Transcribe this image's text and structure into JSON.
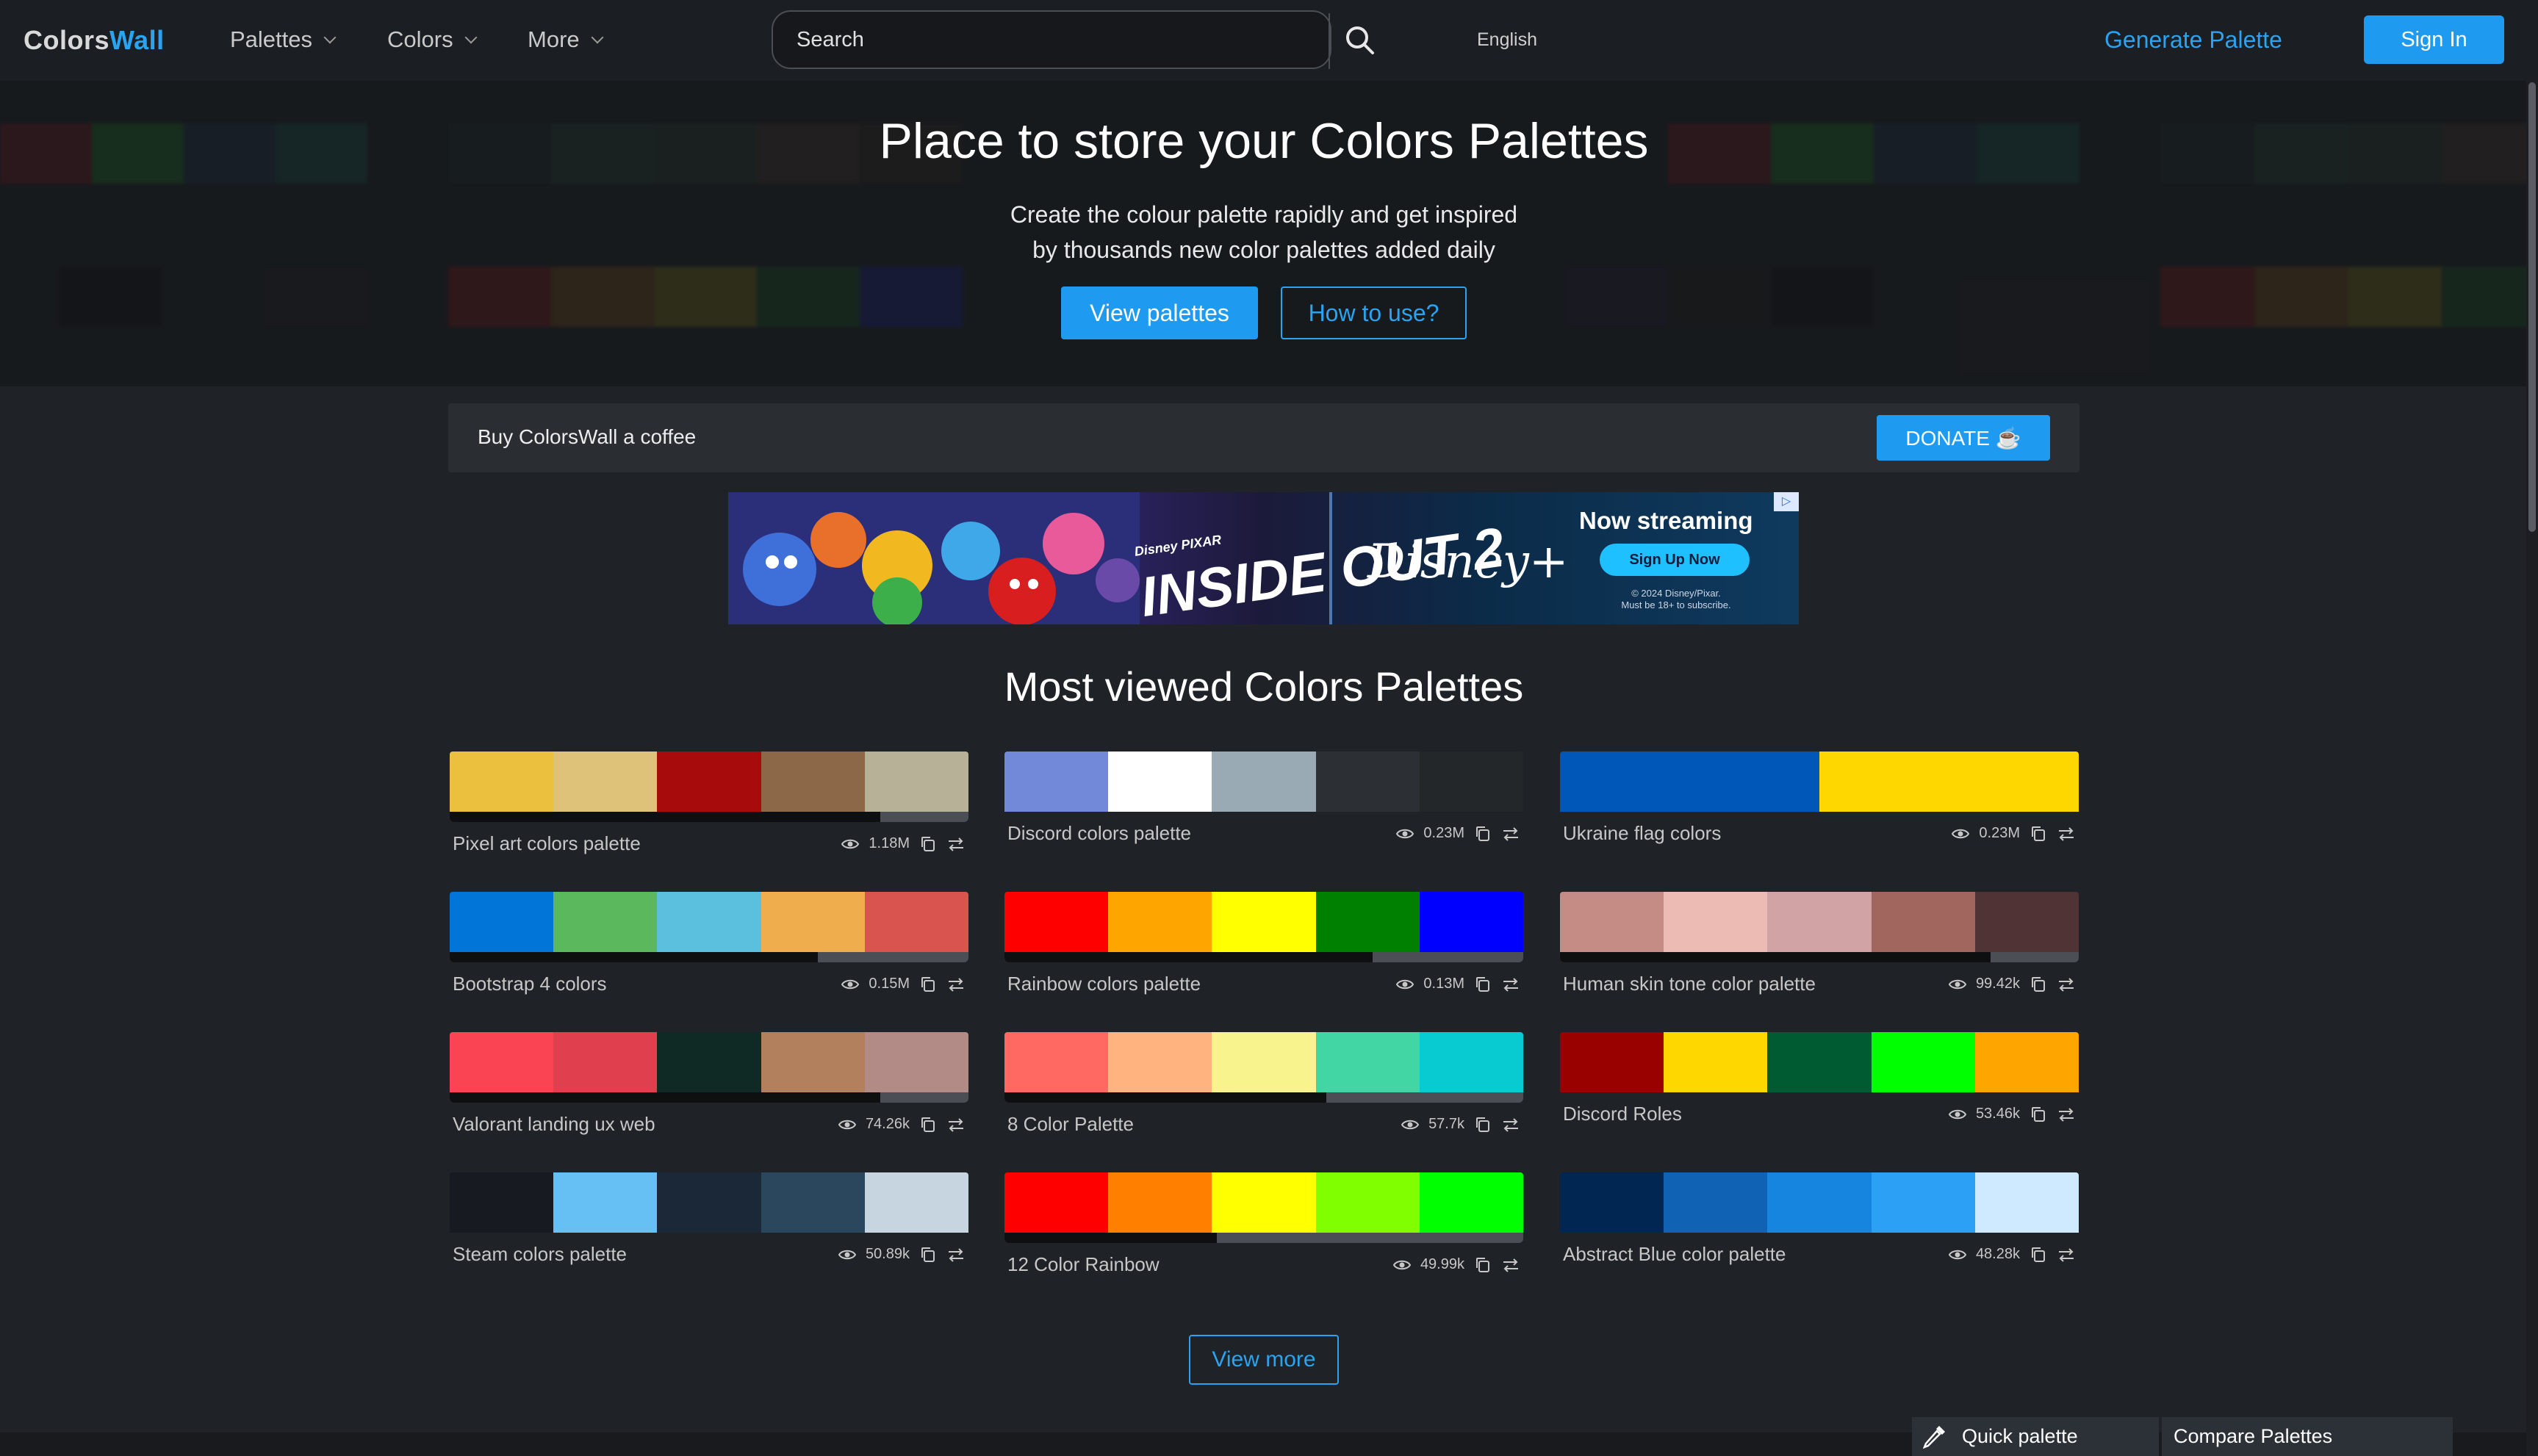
{
  "header": {
    "logo_part1": "Colors",
    "logo_part2": "Wall",
    "nav": [
      {
        "label": "Palettes"
      },
      {
        "label": "Colors"
      },
      {
        "label": "More"
      }
    ],
    "search_placeholder": "Search",
    "language": "English",
    "generate_label": "Generate Palette",
    "signin_label": "Sign In"
  },
  "hero": {
    "title": "Place to store your Colors Palettes",
    "subtitle_line1": "Create the colour palette rapidly and get inspired",
    "subtitle_line2": "by thousands new color palettes added daily",
    "view_palettes_label": "View palettes",
    "how_to_use_label": "How to use?"
  },
  "coffee": {
    "text": "Buy ColorsWall a coffee",
    "donate_label": "DONATE"
  },
  "ad": {
    "title": "INSIDE OUT 2",
    "title_kicker": "Disney PIXAR",
    "brand": "Disney+",
    "headline": "Now streaming",
    "cta": "Sign Up Now",
    "legal_line1": "© 2024 Disney/Pixar.",
    "legal_line2": "Must be 18+ to subscribe."
  },
  "section_title": "Most viewed Colors Palettes",
  "palettes": [
    {
      "name": "Pixel art colors palette",
      "views": "1.18M",
      "popularity": 0.83,
      "colors": [
        "#ebc03f",
        "#dfc27a",
        "#a80b0c",
        "#8c6748",
        "#b6b197"
      ]
    },
    {
      "name": "Discord colors palette",
      "views": "0.23M",
      "popularity": 0,
      "colors": [
        "#7289da",
        "#ffffff",
        "#99aab5",
        "#2c2f33",
        "#23272a"
      ]
    },
    {
      "name": "Ukraine flag colors",
      "views": "0.23M",
      "popularity": 0,
      "colors": [
        "#0057b7",
        "#ffd700"
      ]
    },
    {
      "name": "Bootstrap 4 colors",
      "views": "0.15M",
      "popularity": 0.71,
      "colors": [
        "#0275d8",
        "#5cb85c",
        "#5bc0de",
        "#f0ad4e",
        "#d9534f"
      ]
    },
    {
      "name": "Rainbow colors palette",
      "views": "0.13M",
      "popularity": 0.71,
      "colors": [
        "#ff0000",
        "#ffa500",
        "#ffff00",
        "#008000",
        "#0000ff"
      ]
    },
    {
      "name": "Human skin tone color palette",
      "views": "99.42k",
      "popularity": 0.83,
      "colors": [
        "#c58c85",
        "#ecbcb4",
        "#d1a3a4",
        "#a1665e",
        "#503335"
      ]
    },
    {
      "name": "Valorant landing ux web",
      "views": "74.26k",
      "popularity": 0.83,
      "colors": [
        "#fa4454",
        "#e0404e",
        "#0f2a25",
        "#b3805d",
        "#b28b86"
      ]
    },
    {
      "name": "8 Color Palette",
      "views": "57.7k",
      "popularity": 0.62,
      "colors": [
        "#ff6961",
        "#ffb480",
        "#f8f38d",
        "#42d6a4",
        "#08cad1"
      ]
    },
    {
      "name": "Discord Roles",
      "views": "53.46k",
      "popularity": 0,
      "colors": [
        "#990000",
        "#ffd700",
        "#005a32",
        "#00ff00",
        "#ffa500"
      ]
    },
    {
      "name": "Steam colors palette",
      "views": "50.89k",
      "popularity": 0,
      "colors": [
        "#171a21",
        "#66c0f4",
        "#1b2838",
        "#2a475e",
        "#c7d5e0"
      ]
    },
    {
      "name": "12 Color Rainbow",
      "views": "49.99k",
      "popularity": 0.41,
      "colors": [
        "#ff0000",
        "#ff7f00",
        "#ffff00",
        "#80ff00",
        "#00ff00"
      ]
    },
    {
      "name": "Abstract Blue color palette",
      "views": "48.28k",
      "popularity": 0,
      "colors": [
        "#002651",
        "#0f62b4",
        "#1585e0",
        "#2ba0f5",
        "#cfe9ff"
      ]
    }
  ],
  "view_more_label": "View more",
  "footer": {
    "quick_palette_label": "Quick palette",
    "compare_label": "Compare Palettes"
  },
  "icons": {
    "views": "eye-icon",
    "copy": "copy-icon",
    "compare": "compare-arrows-icon",
    "search": "search-icon",
    "eyedropper": "eyedropper-icon"
  },
  "colors": {
    "accent": "#1e9bf0",
    "background": "#1f2226",
    "header": "#1b1e22"
  }
}
